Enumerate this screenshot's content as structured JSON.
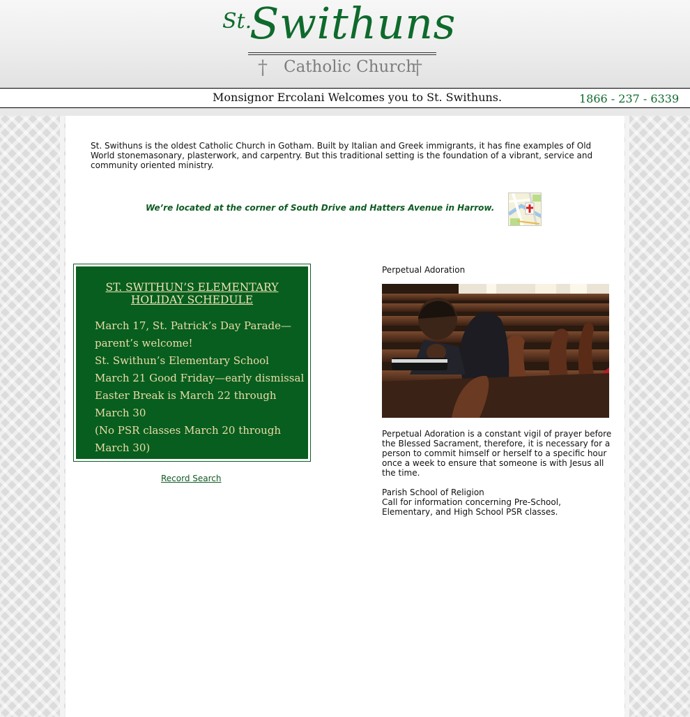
{
  "header": {
    "logo_prefix": "St.",
    "logo_name": "Swithuns",
    "logo_subtitle": "Catholic Church",
    "logo_cross": "†"
  },
  "welcome_bar": {
    "welcome_text": "Monsignor Ercolani Welcomes you to St. Swithuns.",
    "phone": "1866 - 237 - 6339"
  },
  "intro": {
    "text": "St. Swithuns is the oldest Catholic Church in Gotham. Built by Italian and Greek immigrants, it has fine examples of Old World stonemasonary, plasterwork, and carpentry. But this traditional setting is the foundation of a vibrant, service and community oriented ministry."
  },
  "location": {
    "text": "We’re located at the corner of South Drive and Hatters Avenue in Harrow.",
    "map_icon": "map-icon"
  },
  "schedule": {
    "title_line1": "ST. SWITHUN’S ELEMENTARY",
    "title_line2": "HOLIDAY SCHEDULE",
    "lines": [
      "March 17, St. Patrick’s Day Parade—",
      "parent’s welcome!",
      "St. Swithun’s Elementary School",
      "March 21 Good Friday—early dismissal",
      "Easter Break is March 22 through",
      "March 30",
      "(No PSR classes March 20 through",
      "March 30)"
    ]
  },
  "record_search": {
    "label": "Record Search"
  },
  "perpetual_adoration": {
    "heading": "Perpetual Adoration",
    "text": "Perpetual Adoration is a constant vigil of prayer before the Blessed Sacrament, therefore, it is necessary for a person to commit himself or herself to a specific hour once a week to ensure that someone is with Jesus all the time."
  },
  "psr": {
    "heading": "Parish School of Religion",
    "text": "Call for information concerning Pre-School, Elementary, and High School PSR classes."
  },
  "colors": {
    "brand_green": "#0e6a2c",
    "schedule_bg": "#075e1f",
    "schedule_text": "#ecdca8"
  }
}
